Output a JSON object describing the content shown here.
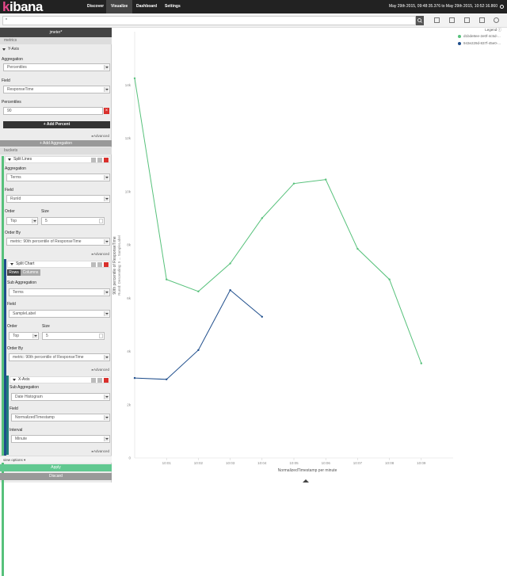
{
  "nav": {
    "brand_k": "k",
    "brand_rest": "ibana",
    "tabs": [
      "Discover",
      "Visualize",
      "Dashboard",
      "Settings"
    ],
    "active_tab": "Visualize",
    "time_range": "May 29th 2015, 09:48:35.376 to May 29th 2015, 10:52:16.860"
  },
  "search": {
    "value": "*"
  },
  "sidebar": {
    "title": "jmeter*",
    "metrics_label": "metrics",
    "yaxis_label": "Y-Axis",
    "aggregation_label": "Aggregation",
    "aggregation_value": "Percentiles",
    "field_label": "Field",
    "field_value": "ResponseTime",
    "percentiles_label": "Percentiles",
    "percentile_value": "90",
    "add_percent": "+ Add Percent",
    "advanced_1": "▸Advanced",
    "add_aggregation": "+ Add Aggregation",
    "buckets_label": "buckets",
    "split_lines_label": "Split Lines",
    "sl_aggregation_label": "Aggregation",
    "sl_aggregation_value": "Terms",
    "sl_field_label": "Field",
    "sl_field_value": "RunId",
    "sl_order_label": "Order",
    "sl_order_value": "Top",
    "sl_size_label": "Size",
    "sl_size_value": "5",
    "sl_orderby_label": "Order By",
    "sl_orderby_value": "metric: 90th percentile of ResponseTime",
    "advanced_2": "▸Advanced",
    "split_chart_label": "Split Chart",
    "rows_label": "Rows",
    "columns_label": "Columns",
    "sc_subagg_label": "Sub Aggregation",
    "sc_subagg_value": "Terms",
    "sc_field_label": "Field",
    "sc_field_value": "SampleLabel",
    "sc_order_label": "Order",
    "sc_order_value": "Top",
    "sc_size_label": "Size",
    "sc_size_value": "5",
    "sc_orderby_label": "Order By",
    "sc_orderby_value": "metric: 90th percentile of ResponseTime",
    "advanced_3": "▸Advanced",
    "xaxis_label": "X-Axis",
    "xa_subagg_label": "Sub Aggregation",
    "xa_subagg_value": "Date Histogram",
    "xa_field_label": "Field",
    "xa_field_value": "NormalizedTimestamp",
    "xa_interval_label": "Interval",
    "xa_interval_value": "Minute",
    "advanced_4": "▸Advanced",
    "view_options": "view options ▾",
    "apply": "Apply",
    "discard": "Discard"
  },
  "legend": {
    "title": "Legend ⓘ",
    "items": [
      {
        "label": "d1bde8ee-2e0f-4c5d-...",
        "color": "#57c17b"
      },
      {
        "label": "943e229d-837f-45e0-...",
        "color": "#1f4e8c"
      }
    ]
  },
  "colors": {
    "green_series": "#57c17b",
    "blue_series": "#1f4e8c",
    "accent": "#61c890"
  },
  "chart_data": {
    "type": "line",
    "xlabel": "NormalizedTimestamp per minute",
    "ylabel": "90th percentile of ResponseTime",
    "ylabel2": "RunId: Descending: 5 ... SampleLabel",
    "ylim": [
      0,
      16000
    ],
    "yticks": [
      0,
      2000,
      4000,
      6000,
      8000,
      10000,
      12000,
      14000
    ],
    "ytick_labels": [
      "0",
      "2k",
      "4k",
      "6k",
      "8k",
      "10k",
      "12k",
      "14k"
    ],
    "xticks": [
      "10:01",
      "10:02",
      "10:03",
      "10:04",
      "10:05",
      "10:06",
      "10:07",
      "10:08",
      "10:09"
    ],
    "x": [
      0,
      1,
      2,
      3,
      4,
      5,
      6,
      7,
      8,
      9
    ],
    "series": [
      {
        "color": "#57c17b",
        "x": [
          0,
          1,
          2,
          3,
          4,
          5,
          6,
          7,
          8,
          9
        ],
        "values": [
          14250,
          6700,
          6250,
          7300,
          9000,
          10300,
          10450,
          7850,
          6700,
          3550
        ]
      },
      {
        "color": "#1f4e8c",
        "x": [
          0,
          1,
          2,
          3,
          4
        ],
        "values": [
          3000,
          2950,
          4050,
          6300,
          5300
        ]
      }
    ]
  }
}
